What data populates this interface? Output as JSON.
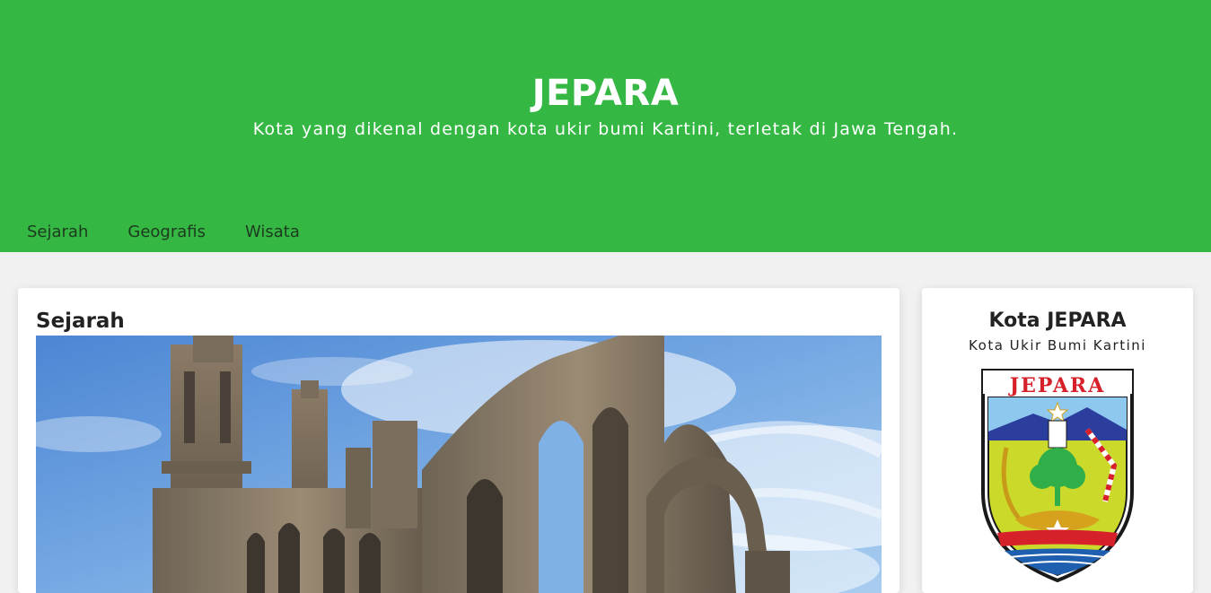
{
  "header": {
    "title": "JEPARA",
    "subtitle": "Kota yang dikenal dengan kota ukir bumi Kartini, terletak di Jawa Tengah.",
    "bg_color": "#35b843"
  },
  "nav": {
    "items": [
      {
        "label": "Sejarah"
      },
      {
        "label": "Geografis"
      },
      {
        "label": "Wisata"
      }
    ]
  },
  "main": {
    "heading": "Sejarah",
    "image": "ruined-gothic-abbey-photo"
  },
  "sidebar": {
    "title": "Kota JEPARA",
    "subtitle": "Kota Ukir Bumi Kartini",
    "emblem_text": "JEPARA",
    "emblem": "jepara-coat-of-arms"
  }
}
